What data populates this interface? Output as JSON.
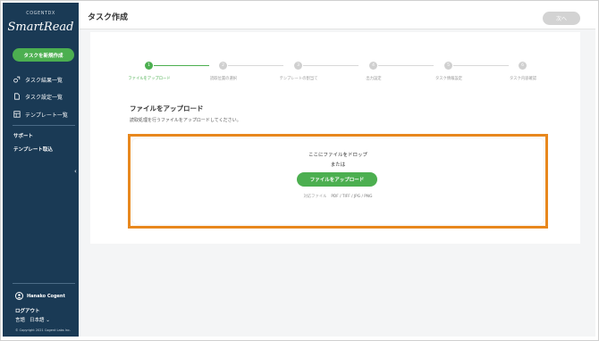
{
  "sidebar": {
    "brand_top": "COGENTDX",
    "brand_main": "SmartRead",
    "new_task_label": "タスクを新規作成",
    "nav": [
      {
        "label": "タスク結果一覧",
        "icon": "task-results-icon"
      },
      {
        "label": "タスク設定一覧",
        "icon": "document-icon"
      },
      {
        "label": "テンプレート一覧",
        "icon": "template-icon"
      }
    ],
    "support_label": "サポート",
    "template_import_label": "テンプレート取込",
    "collapse_glyph": "‹",
    "user_name": "Hanako Cogent",
    "logout_label": "ログアウト",
    "lang_label": "言語",
    "lang_value": "日本語 ⌄",
    "copyright": "© Copyright 2021 Cogent Labs Inc."
  },
  "header": {
    "title": "タスク作成",
    "next_label": "次へ"
  },
  "stepper": {
    "steps": [
      {
        "num": "1",
        "label": "ファイルをアップロード",
        "active": true
      },
      {
        "num": "2",
        "label": "読取位置の選択",
        "active": false
      },
      {
        "num": "3",
        "label": "テンプレートの割当て",
        "active": false
      },
      {
        "num": "4",
        "label": "出力設定",
        "active": false
      },
      {
        "num": "5",
        "label": "タスク情報設定",
        "active": false
      },
      {
        "num": "6",
        "label": "タスク内容確認",
        "active": false
      }
    ]
  },
  "upload": {
    "title": "ファイルをアップロード",
    "description": "読取処理を行うファイルをアップロードしてください。",
    "drop_text": "ここにファイルをドロップ",
    "or_text": "または",
    "button_label": "ファイルをアップロード",
    "formats_label": "対応ファイル",
    "formats_value": "PDF / TIFF / JPG / PNG"
  },
  "colors": {
    "sidebar_bg": "#1a3a55",
    "accent_green": "#4caf50",
    "highlight_orange": "#e8881e"
  }
}
